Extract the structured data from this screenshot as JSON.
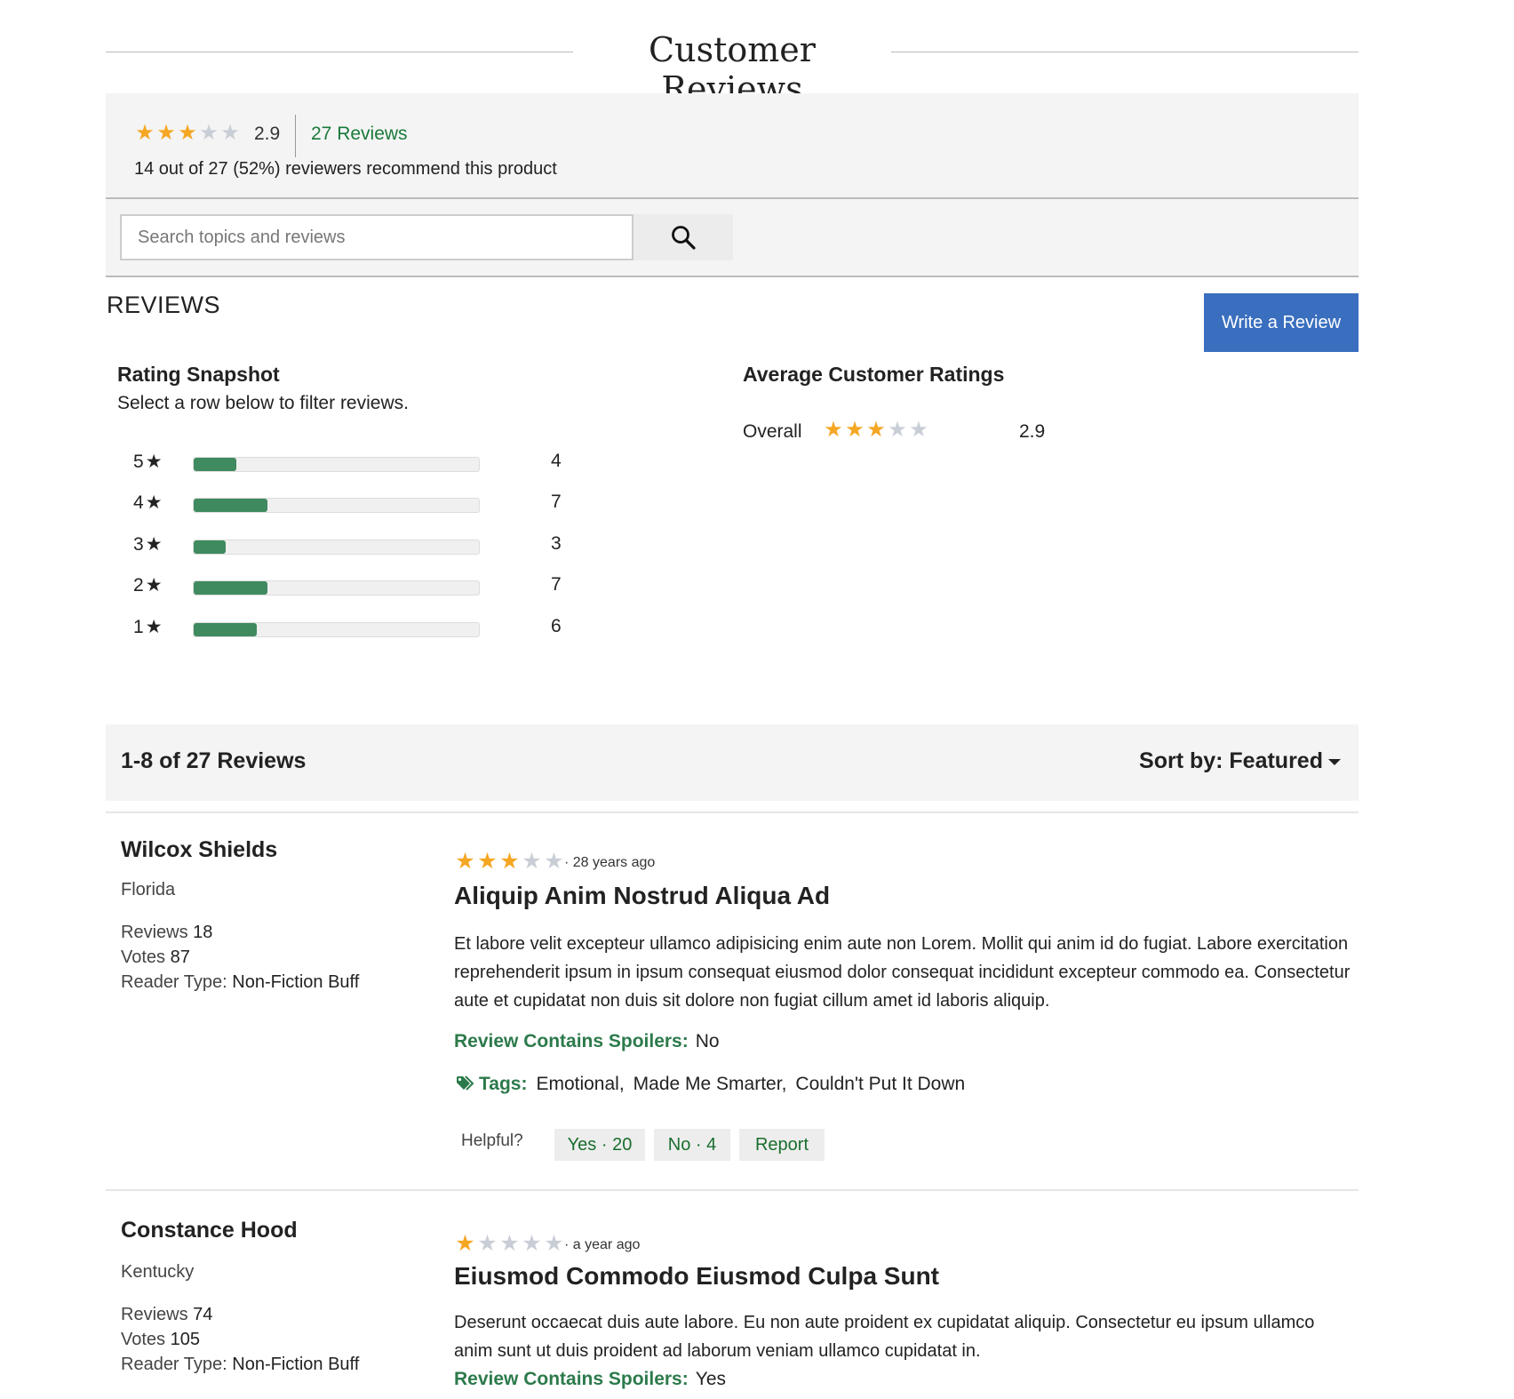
{
  "header": {
    "title": "Customer Reviews"
  },
  "summary": {
    "average": "2.9",
    "average_value": 2.9,
    "stars_filled": 3,
    "review_count_link": "27 Reviews",
    "recommend_text": "14 out of 27 (52%) reviewers recommend this product"
  },
  "search": {
    "placeholder": "Search topics and reviews",
    "icon": "search-icon"
  },
  "reviews_section": {
    "heading": "REVIEWS",
    "write_button": "Write a Review"
  },
  "snapshot": {
    "title": "Rating Snapshot",
    "subtitle": "Select a row below to filter reviews.",
    "rows": [
      {
        "label": "5",
        "count": "4",
        "fraction": 0.148
      },
      {
        "label": "4",
        "count": "7",
        "fraction": 0.259
      },
      {
        "label": "3",
        "count": "3",
        "fraction": 0.111
      },
      {
        "label": "2",
        "count": "7",
        "fraction": 0.259
      },
      {
        "label": "1",
        "count": "6",
        "fraction": 0.222
      }
    ]
  },
  "average_ratings": {
    "title": "Average Customer Ratings",
    "overall_label": "Overall",
    "overall_value": "2.9",
    "stars_filled": 3
  },
  "list": {
    "count_text": "1-8 of 27 Reviews",
    "sort_label": "Sort by: Featured"
  },
  "reviews": [
    {
      "author": "Wilcox Shields",
      "location": "Florida",
      "reviews_label": "Reviews",
      "reviews_count": "18",
      "votes_label": "Votes",
      "votes_count": "87",
      "reader_type_label": "Reader Type:",
      "reader_type": "Non-Fiction Buff",
      "stars_filled": 3,
      "date": "· 28 years ago",
      "title": "Aliquip Anim Nostrud Aliqua Ad",
      "body": "Et labore velit excepteur ullamco adipisicing enim aute non Lorem. Mollit qui anim id do fugiat. Labore exercitation reprehenderit ipsum in ipsum consequat eiusmod dolor consequat incididunt excepteur commodo ea. Consectetur aute et cupidatat non duis sit dolore non fugiat cillum amet id laboris aliquip.",
      "spoiler_label": "Review Contains Spoilers:",
      "spoiler_value": "No",
      "tags_label": "Tags:",
      "tags": [
        "Emotional,",
        "Made Me Smarter,",
        "Couldn't Put It Down"
      ],
      "helpful_label": "Helpful?",
      "yes_label": "Yes · 20",
      "no_label": "No · 4",
      "report_label": "Report"
    },
    {
      "author": "Constance Hood",
      "location": "Kentucky",
      "reviews_label": "Reviews",
      "reviews_count": "74",
      "votes_label": "Votes",
      "votes_count": "105",
      "reader_type_label": "Reader Type:",
      "reader_type": "Non-Fiction Buff",
      "stars_filled": 1,
      "date": "· a year ago",
      "title": "Eiusmod Commodo Eiusmod Culpa Sunt",
      "body": "Deserunt occaecat duis aute labore. Eu non aute proident ex cupidatat aliquip. Consectetur eu ipsum ullamco anim sunt ut duis proident ad laborum veniam ullamco cupidatat in.",
      "spoiler_label": "Review Contains Spoilers:",
      "spoiler_value": "Yes"
    }
  ],
  "colors": {
    "accent_green": "#2c7a4b",
    "star_gold": "#f5a623",
    "button_blue": "#3a6fbf",
    "bar_fill": "#3f8a5f"
  }
}
